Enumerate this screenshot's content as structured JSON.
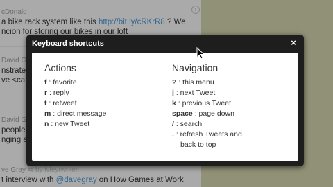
{
  "timeline": {
    "tweets": [
      {
        "author": "cDonald",
        "lines": [
          {
            "pre": "a bike rack system like this ",
            "link": "http://bit.ly/cRKrR8",
            "post": " ? We"
          },
          {
            "pre": "ncion for storing our bikes in our loft",
            "link": "",
            "post": ""
          }
        ]
      },
      {
        "author": "David Gr",
        "lines": [
          {
            "pre": "nstrates",
            "link": "",
            "post": ""
          },
          {
            "pre": "ve <can",
            "link": "",
            "post": ""
          }
        ]
      },
      {
        "author": "David Gr",
        "lines": [
          {
            "pre": "people",
            "link": "",
            "post": ""
          },
          {
            "pre": "nging e",
            "link": "",
            "post": ""
          }
        ]
      },
      {
        "author": "ve Gray",
        "retweet": "by ivleyrwrker",
        "lines": [
          {
            "pre": "t interview with ",
            "link": "@davegray",
            "post": " on How Games at Work"
          }
        ]
      }
    ]
  },
  "modal": {
    "title": "Keyboard shortcuts",
    "close_symbol": "×",
    "columns": [
      {
        "heading": "Actions",
        "rows": [
          {
            "key": "f",
            "desc": ": favorite"
          },
          {
            "key": "r",
            "desc": ": reply"
          },
          {
            "key": "t",
            "desc": ": retweet"
          },
          {
            "key": "m",
            "desc": ": direct message"
          },
          {
            "key": "n",
            "desc": ": new Tweet"
          }
        ]
      },
      {
        "heading": "Navigation",
        "rows": [
          {
            "key": "?",
            "desc": ": this menu"
          },
          {
            "key": "j",
            "desc": ": next Tweet"
          },
          {
            "key": "k",
            "desc": ": previous Tweet"
          },
          {
            "key": "space",
            "desc": ": page down"
          },
          {
            "key": "/",
            "desc": ": search"
          },
          {
            "key": ".",
            "desc": ": refresh Tweets and"
          },
          {
            "key": "",
            "desc": "back to top"
          }
        ]
      }
    ]
  },
  "colors": {
    "modal_bg": "#1e1e1e",
    "link": "#4a90c8",
    "page_bg": "#c9c9a6"
  }
}
